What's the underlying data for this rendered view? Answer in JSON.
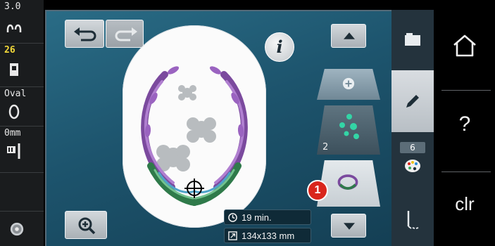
{
  "status_column": {
    "thread_tension": "3.0",
    "needle_count": "26",
    "hoop_name": "Oval",
    "feed_value": "0mm"
  },
  "toolbar": {
    "undo_icon": "undo-arrow-icon",
    "redo_icon": "redo-arrow-icon",
    "info_label": "i"
  },
  "layers": {
    "add_icon": "plus-icon",
    "layer2_number": "2",
    "selected_marker": "1"
  },
  "design_info": {
    "time": "19 min.",
    "size": "134x133 mm"
  },
  "tabs": {
    "selection_icon": "folder-icon",
    "edit_icon": "pencil-icon",
    "color_count": "6",
    "color_icon": "palette-icon",
    "stitch_icon": "needle-stitch-icon"
  },
  "system": {
    "home_icon": "home-icon",
    "help_label": "?",
    "clear_label": "clr"
  },
  "colors": {
    "accent": "#d9261c",
    "screen_bg": "#1d546d",
    "panel_grey": "#c5cbd0"
  }
}
